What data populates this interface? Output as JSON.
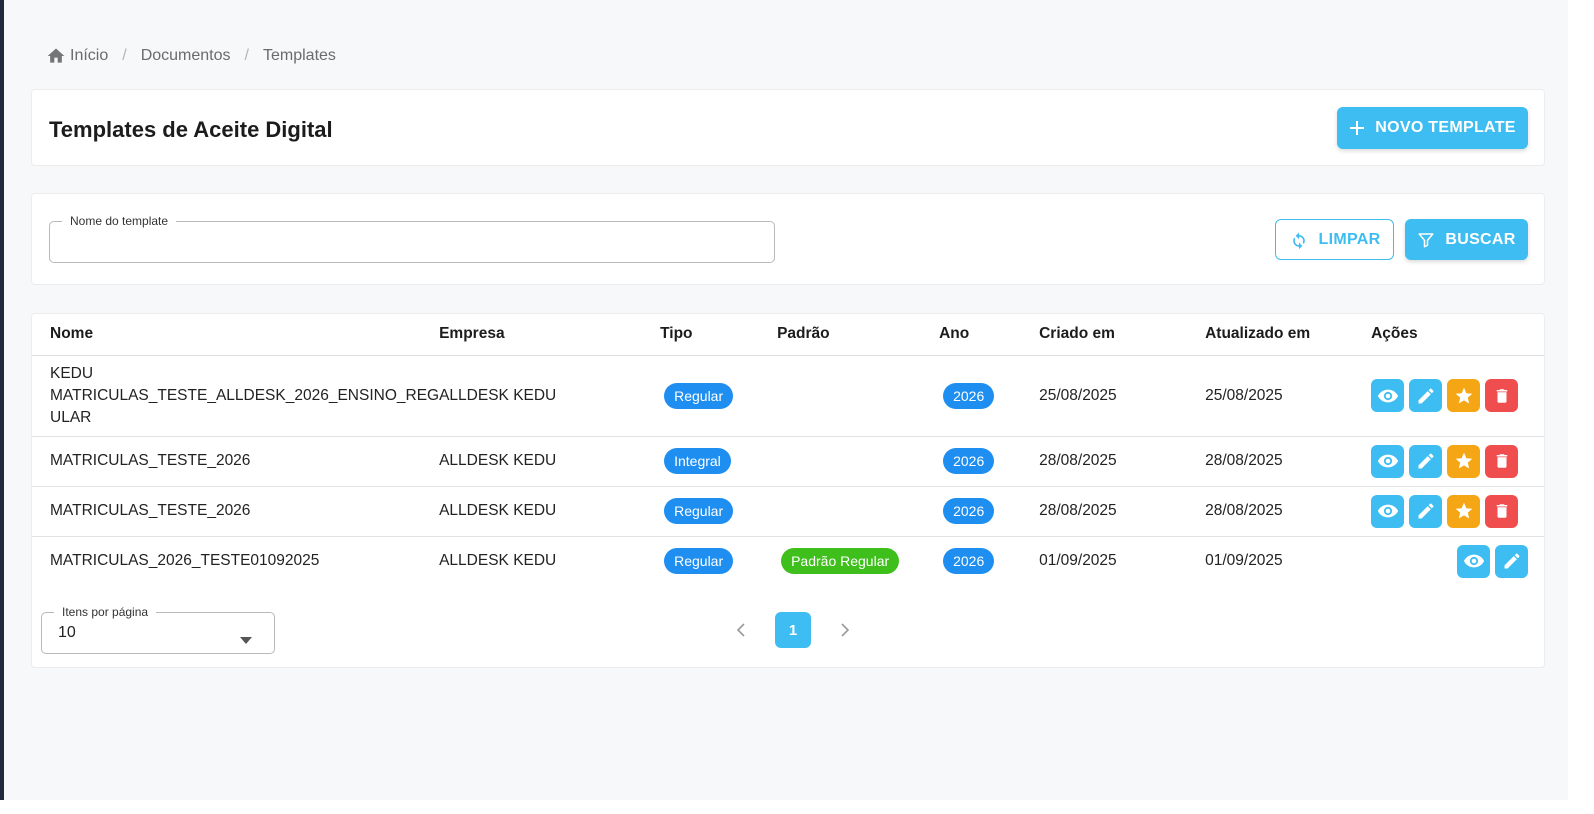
{
  "breadcrumb": {
    "items": [
      "Início",
      "Documentos",
      "Templates"
    ],
    "separator": "/"
  },
  "header": {
    "title": "Templates de Aceite Digital",
    "new_button": "NOVO TEMPLATE"
  },
  "filter": {
    "name_label": "Nome do template",
    "name_value": "",
    "clear_button": "LIMPAR",
    "search_button": "BUSCAR"
  },
  "table": {
    "columns": [
      "Nome",
      "Empresa",
      "Tipo",
      "Padrão",
      "Ano",
      "Criado em",
      "Atualizado em",
      "Ações"
    ],
    "rows": [
      {
        "name_lines": [
          "KEDU",
          "MATRICULAS_TESTE_ALLDESK_2026_ENSINO_REG",
          "ULAR"
        ],
        "empresa": "ALLDESK KEDU",
        "tipo": "Regular",
        "padrao": "",
        "ano": "2026",
        "criado": "25/08/2025",
        "atualizado": "25/08/2025",
        "actions": [
          "view",
          "edit",
          "star",
          "delete"
        ]
      },
      {
        "name_lines": [
          "MATRICULAS_TESTE_2026"
        ],
        "empresa": "ALLDESK KEDU",
        "tipo": "Integral",
        "padrao": "",
        "ano": "2026",
        "criado": "28/08/2025",
        "atualizado": "28/08/2025",
        "actions": [
          "view",
          "edit",
          "star",
          "delete"
        ]
      },
      {
        "name_lines": [
          "MATRICULAS_TESTE_2026"
        ],
        "empresa": "ALLDESK KEDU",
        "tipo": "Regular",
        "padrao": "",
        "ano": "2026",
        "criado": "28/08/2025",
        "atualizado": "28/08/2025",
        "actions": [
          "view",
          "edit",
          "star",
          "delete"
        ]
      },
      {
        "name_lines": [
          "MATRICULAS_2026_TESTE01092025"
        ],
        "empresa": "ALLDESK KEDU",
        "tipo": "Regular",
        "padrao": "Padrão Regular",
        "ano": "2026",
        "criado": "01/09/2025",
        "atualizado": "01/09/2025",
        "actions": [
          "view",
          "edit"
        ]
      }
    ]
  },
  "pagination": {
    "per_page_label": "Itens por página",
    "per_page_value": "10",
    "current_page": "1"
  },
  "colors": {
    "primary": "#3dbdf1",
    "chip_blue": "#1f8ef1",
    "chip_green": "#3fbf1c",
    "star": "#f5a614",
    "delete": "#f04e4e"
  },
  "icons": {
    "breadcrumb_home": "home-icon",
    "new": "plus-icon",
    "clear": "refresh-icon",
    "search": "filter-icon",
    "view": "eye-icon",
    "edit": "pencil-icon",
    "star": "star-icon",
    "delete": "trash-icon"
  }
}
